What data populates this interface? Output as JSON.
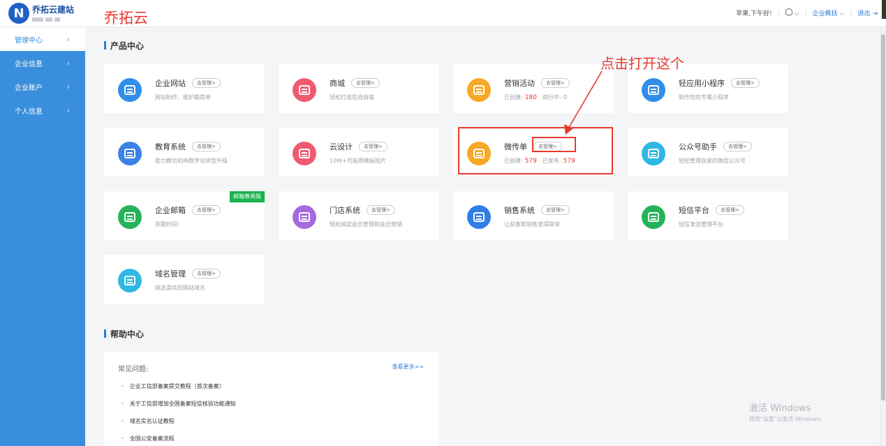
{
  "brand": {
    "name": "乔拓云建站",
    "logo_letter": "N"
  },
  "sidebar": {
    "items": [
      {
        "label": "管理中心",
        "active": true
      },
      {
        "label": "企业信息",
        "active": false
      },
      {
        "label": "企业账户",
        "active": false
      },
      {
        "label": "个人信息",
        "active": false
      }
    ]
  },
  "header": {
    "title": "乔拓云",
    "greeting": "苹果,下午好!",
    "overview_link": "企业概括",
    "logout": "退出"
  },
  "products": {
    "heading": "产品中心",
    "manage_label": "去管理>",
    "cards": [
      {
        "title": "企业网站",
        "desc": "网站制作、维护都简单",
        "icon": "website-icon",
        "color": "#2f8ee8"
      },
      {
        "title": "商城",
        "desc": "轻松打造在线商城",
        "icon": "shop-bag-icon",
        "color": "#ef5a6f"
      },
      {
        "title": "营销活动",
        "desc_prefix": "已创建:",
        "count1": "180",
        "desc_mid": "进行中:",
        "count2": "0",
        "icon": "gift-icon",
        "color": "#f7a826"
      },
      {
        "title": "轻应用小程序",
        "desc": "制作您的专属小程序",
        "icon": "miniapp-icon",
        "color": "#2f8ee8"
      },
      {
        "title": "教育系统",
        "desc": "助力教培机构数字化转型升级",
        "icon": "book-icon",
        "color": "#3c82e6"
      },
      {
        "title": "云设计",
        "desc": "10W+可商用模板图片",
        "icon": "image-icon",
        "color": "#ef5a6f"
      },
      {
        "title": "微传单",
        "desc_prefix": "已创建:",
        "count1": "579",
        "desc_mid": "已发布:",
        "count2": "579",
        "icon": "flyer-icon",
        "color": "#f7a826"
      },
      {
        "title": "公众号助手",
        "desc": "轻松管理自家的微信公众号",
        "icon": "wechat-icon",
        "color": "#2eb8e4"
      },
      {
        "title": "企业邮箱",
        "desc": "到期时间:",
        "icon": "mail-icon",
        "color": "#25b35a",
        "badge": "邮箱尊贵版"
      },
      {
        "title": "门店系统",
        "desc": "轻松搞定会员管理和会员营销",
        "icon": "store-icon",
        "color": "#a56ae0"
      },
      {
        "title": "销售系统",
        "desc": "让获客和销售变得简单",
        "icon": "list-icon",
        "color": "#2f7ee6"
      },
      {
        "title": "短信平台",
        "desc": "短信发送管理平台",
        "icon": "sms-icon",
        "color": "#25b35a"
      },
      {
        "title": "域名管理",
        "desc": "挑选喜欢的网站域名",
        "icon": "domain-icon",
        "color": "#2eb8e4"
      }
    ]
  },
  "annotation": {
    "text": "点击打开这个"
  },
  "help": {
    "heading": "帮助中心",
    "faq_label": "常见问题:",
    "more": "查看更多>>",
    "items": [
      "企业工信部备案提交教程（首次备案）",
      "关于工信部增加全国备案短信核验功能通知",
      "域名实名认证教程",
      "全国公安备案流程"
    ]
  },
  "watermark": {
    "title": "激活 Windows",
    "subtitle": "转到\"设置\"以激活 Windows。"
  }
}
